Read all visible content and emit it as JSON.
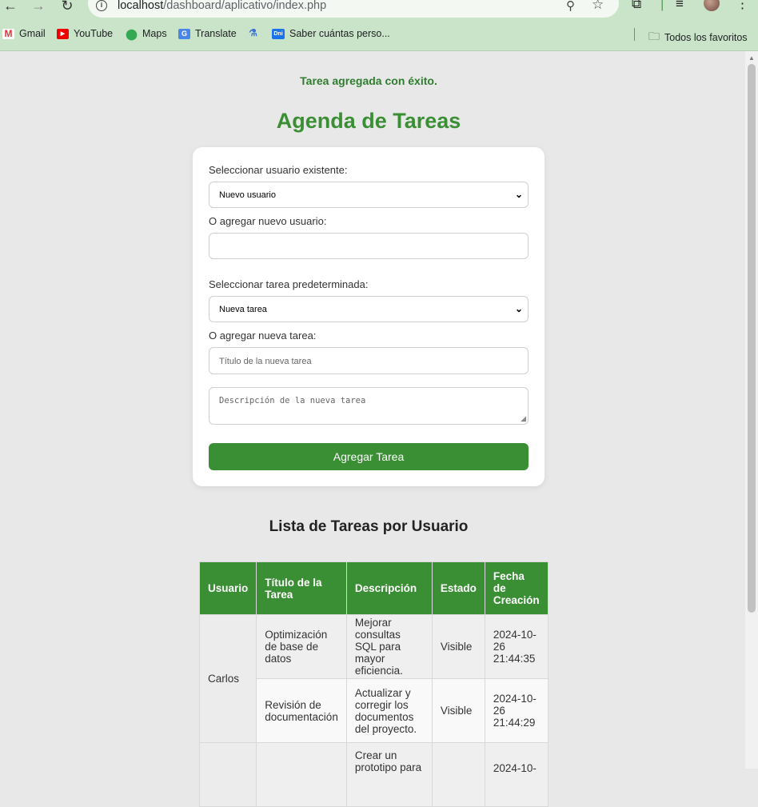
{
  "browser": {
    "url_host": "localhost",
    "url_path": "/dashboard/aplicativo/index.php",
    "bookmarks": [
      {
        "label": "Gmail",
        "icon": "gmail-icon"
      },
      {
        "label": "YouTube",
        "icon": "youtube-icon"
      },
      {
        "label": "Maps",
        "icon": "maps-icon"
      },
      {
        "label": "Translate",
        "icon": "translate-icon"
      },
      {
        "label": "",
        "icon": "labs-icon"
      },
      {
        "label": "Saber cuántas perso...",
        "icon": "dni-icon"
      }
    ],
    "all_bookmarks": "Todos los favoritos"
  },
  "page": {
    "success_message": "Tarea agregada con éxito.",
    "title": "Agenda de Tareas"
  },
  "form": {
    "select_user_label": "Seleccionar usuario existente:",
    "select_user_value": "Nuevo usuario",
    "new_user_label": "O agregar nuevo usuario:",
    "new_user_value": "",
    "select_task_label": "Seleccionar tarea predeterminada:",
    "select_task_value": "Nueva tarea",
    "new_task_label": "O agregar nueva tarea:",
    "task_title_placeholder": "Título de la nueva tarea",
    "task_desc_placeholder": "Descripción de la nueva tarea",
    "submit_label": "Agregar Tarea"
  },
  "tasks": {
    "title": "Lista de Tareas por Usuario",
    "headers": [
      "Usuario",
      "Título de la Tarea",
      "Descripción",
      "Estado",
      "Fecha de Creación"
    ],
    "rows": [
      {
        "user": "Carlos",
        "title": "Optimización de base de datos",
        "desc": "Mejorar consultas SQL para mayor eficiencia.",
        "status": "Visible",
        "date": "2024-10-26 21:44:35"
      },
      {
        "user": "",
        "title": "Revisión de documentación",
        "desc": "Actualizar y corregir los documentos del proyecto.",
        "status": "Visible",
        "date": "2024-10-26 21:44:29"
      },
      {
        "user": "",
        "title": "",
        "desc": "Crear un prototipo para",
        "status": "",
        "date": "2024-10-"
      }
    ]
  },
  "colors": {
    "accent": "#3a8f34",
    "chrome": "#c9e4c9"
  }
}
